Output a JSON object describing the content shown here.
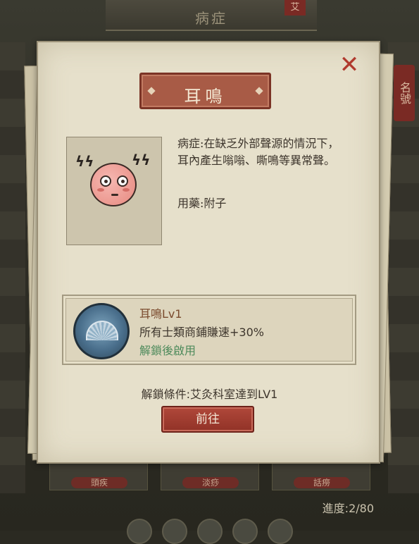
{
  "background": {
    "title": "病症",
    "top_tab": "艾",
    "side_tab": "名號",
    "cards": [
      "頭疾",
      "淡痧",
      "話痨"
    ],
    "progress": "進度:2/80"
  },
  "dialog": {
    "title": "耳鳴",
    "close_icon": "close-x-icon",
    "description": "病症:在缺乏外部聲源的情況下，耳內產生嗡嗡、嘶鳴等異常聲。",
    "medicine": "用藥:附子",
    "skill": {
      "name": "耳鳴Lv1",
      "effect": "所有士類商鋪賺速+30%",
      "status": "解鎖後啟用",
      "icon": "fan-icon"
    },
    "unlock_condition": "解鎖條件:艾灸科室達到LV1",
    "go_button": "前往"
  },
  "colors": {
    "accent_red": "#a85b46",
    "button_red": "#b0483a",
    "status_green": "#4d8a5b",
    "paper": "#e6e0cb"
  }
}
